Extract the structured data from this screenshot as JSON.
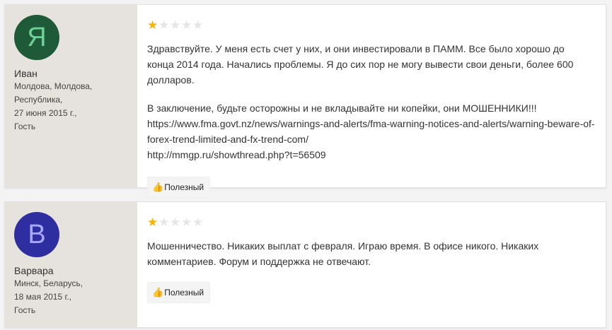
{
  "colors": {
    "avatar1_bg": "#1e5a38",
    "avatar1_fg": "#6fd096",
    "avatar2_bg": "#2e2ea0",
    "avatar2_fg": "#a8a8ff",
    "star_on": "#f4b400",
    "star_off": "#e6e6e6"
  },
  "reviews": [
    {
      "avatar_letter": "Я",
      "author": "Иван",
      "location_line1": "Молдова, Молдова,",
      "location_line2": "Республика,",
      "date": "27 июня 2015 г.,",
      "role": "Гость",
      "rating": 1,
      "rating_max": 5,
      "text": [
        "Здравствуйте. У меня есть счет у них, и они инвестировали в ПАММ. Все было хорошо до конца 2014 года. Начались проблемы. Я до сих пор не могу вывести свои деньги, более 600 долларов.",
        "В заключение, будьте осторожны и не вкладывайте ни копейки, они МОШЕННИКИ!!!",
        "https://www.fma.govt.nz/news/warnings-and-alerts/fma-warning-notices-and-alerts/warning-beware-of-forex-trend-limited-and-fx-trend-com/",
        "http://mmgp.ru/showthread.php?t=56509"
      ],
      "useful_label": "Полезный"
    },
    {
      "avatar_letter": "В",
      "author": "Варвара",
      "location_line1": "Минск, Беларусь,",
      "date": "18 мая 2015 г.,",
      "role": "Гость",
      "rating": 1,
      "rating_max": 5,
      "text": [
        "Мошенничество. Никаких выплат с февраля. Играю время. В офисе никого. Никаких комментариев. Форум и поддержка не отвечают."
      ],
      "useful_label": "Полезный"
    }
  ]
}
